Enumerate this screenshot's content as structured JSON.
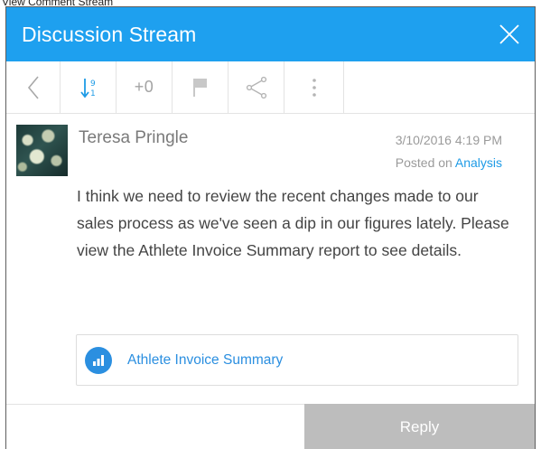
{
  "page": {
    "caption": "View Comment Stream"
  },
  "header": {
    "title": "Discussion Stream",
    "close_icon": "close-icon"
  },
  "toolbar": {
    "back_icon": "chevron-left-icon",
    "sort_icon": "sort-numeric-icon",
    "like_count": "+0",
    "flag_icon": "flag-icon",
    "share_icon": "share-icon",
    "more_icon": "more-vertical-icon"
  },
  "comment": {
    "author": "Teresa Pringle",
    "timestamp": "3/10/2016 4:19 PM",
    "posted_prefix": "Posted on",
    "posted_link": "Analysis",
    "text": "I think we need to review the recent changes made to our sales process as we've seen a dip in our figures lately. Please view the Athlete Invoice Summary report to see details.",
    "attachment": {
      "label": "Athlete Invoice Summary",
      "icon": "bar-chart-icon"
    }
  },
  "footer": {
    "reply_label": "Reply"
  },
  "colors": {
    "accent": "#1ea0ef",
    "link": "#1e9be6",
    "reply_disabled": "#bdbdbd"
  }
}
